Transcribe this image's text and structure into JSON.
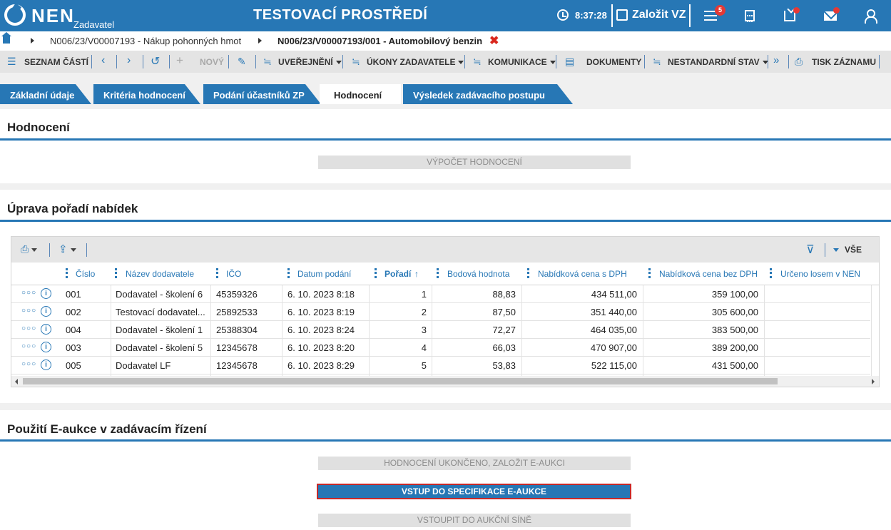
{
  "header": {
    "brand": "NEN",
    "role": "Zadavatel",
    "environment": "TESTOVACÍ PROSTŘEDÍ",
    "time": "8:37:28",
    "create_label": "Založit VZ",
    "notifications_count": "5"
  },
  "breadcrumb": {
    "item1": "N006/23/V00007193 - Nákup pohonných hmot",
    "item2": "N006/23/V00007193/001 - Automobilový benzin",
    "close": "✖"
  },
  "toolbar": {
    "parts": "SEZNAM ČÁSTÍ",
    "new": "NOVÝ",
    "publish": "UVEŘEJNĚNÍ",
    "actions": "ÚKONY ZADAVATELE",
    "communication": "KOMUNIKACE",
    "documents": "DOKUMENTY",
    "nonstandard": "NESTANDARDNÍ STAV",
    "print": "TISK ZÁZNAMU"
  },
  "tabs": [
    {
      "label": "Základní údaje"
    },
    {
      "label": "Kritéria hodnocení"
    },
    {
      "label": "Podání účastníků ZP"
    },
    {
      "label": "Hodnocení"
    },
    {
      "label": "Výsledek zadávacího postupu"
    }
  ],
  "active_tab": "Hodnocení",
  "sections": {
    "evaluation": {
      "title": "Hodnocení",
      "compute_button": "VÝPOČET HODNOCENÍ"
    },
    "order": {
      "title": "Úprava pořadí nabídek",
      "filter_all": "VŠE"
    },
    "eauction": {
      "title": "Použití E-aukce v zadávacím řízení",
      "btn_finish": "HODNOCENÍ UKONČENO, ZALOŽIT E-AUKCI",
      "btn_spec": "VSTUP DO SPECIFIKACE E-AUKCE",
      "btn_hall": "VSTOUPIT DO AUKČNÍ SÍNĚ"
    }
  },
  "table": {
    "columns": [
      "Číslo",
      "Název dodavatele",
      "IČO",
      "Datum podání",
      "Pořadí",
      "Bodová hodnota",
      "Nabídková cena s DPH",
      "Nabídková cena bez DPH",
      "Určeno losem v NEN"
    ],
    "sort_indicator": "↑",
    "rows": [
      {
        "cislo": "001",
        "nazev": "Dodavatel - školení 6",
        "ico": "45359326",
        "datum": "6. 10. 2023 8:18",
        "poradi": "1",
        "body": "88,83",
        "s_dph": "434 511,00",
        "bez_dph": "359 100,00",
        "los": ""
      },
      {
        "cislo": "002",
        "nazev": "Testovací dodavatel...",
        "ico": "25892533",
        "datum": "6. 10. 2023 8:19",
        "poradi": "2",
        "body": "87,50",
        "s_dph": "351 440,00",
        "bez_dph": "305 600,00",
        "los": ""
      },
      {
        "cislo": "004",
        "nazev": "Dodavatel - školení 1",
        "ico": "25388304",
        "datum": "6. 10. 2023 8:24",
        "poradi": "3",
        "body": "72,27",
        "s_dph": "464 035,00",
        "bez_dph": "383 500,00",
        "los": ""
      },
      {
        "cislo": "003",
        "nazev": "Dodavatel - školení 5",
        "ico": "12345678",
        "datum": "6. 10. 2023 8:20",
        "poradi": "4",
        "body": "66,03",
        "s_dph": "470 907,00",
        "bez_dph": "389 200,00",
        "los": ""
      },
      {
        "cislo": "005",
        "nazev": "Dodavatel LF",
        "ico": "12345678",
        "datum": "6. 10. 2023 8:29",
        "poradi": "5",
        "body": "53,83",
        "s_dph": "522 115,00",
        "bez_dph": "431 500,00",
        "los": ""
      }
    ]
  },
  "colors": {
    "primary": "#2777b5",
    "danger": "#d9261c",
    "disabled_bg": "#e0e0e0"
  }
}
